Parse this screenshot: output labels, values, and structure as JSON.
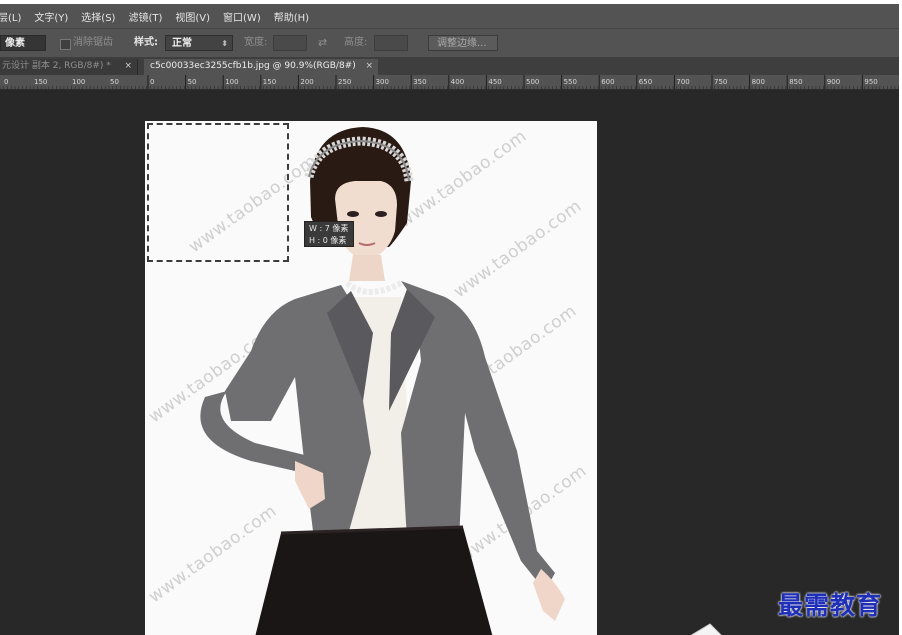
{
  "menu": {
    "items": [
      "层(L)",
      "文字(Y)",
      "选择(S)",
      "滤镜(T)",
      "视图(V)",
      "窗口(W)",
      "帮助(H)"
    ]
  },
  "options": {
    "feather_value": "像素",
    "antialias_label": "消除锯齿",
    "style_label": "样式:",
    "style_value": "正常",
    "width_label": "宽度:",
    "height_label": "高度:",
    "refine_edge_button": "调整边缘..."
  },
  "tabs": [
    {
      "label": "元设计 副本 2, RGB/8#) *",
      "active": false
    },
    {
      "label": "c5c00033ec3255cfb1b.jpg @ 90.9%(RGB/8#)",
      "active": true
    }
  ],
  "ruler": {
    "left_labels": [
      "0",
      "150",
      "100",
      "50"
    ],
    "labels": [
      "0",
      "50",
      "100",
      "150",
      "200",
      "250",
      "300",
      "350",
      "400",
      "450",
      "500",
      "550",
      "600",
      "650",
      "700",
      "750",
      "800",
      "850",
      "900",
      "950"
    ]
  },
  "tooltip": {
    "w_line": "W : 7 像素",
    "h_line": "H : 0 像素"
  },
  "watermark": {
    "text": "www.taobao.com"
  },
  "brand": {
    "text": "最需教育",
    "color": "#1f2fb8"
  },
  "colors": {
    "menubar_bg": "#535353",
    "workspace_bg": "#282828",
    "document_bg": "#fafafa",
    "jacket": "#6f6f72",
    "skirt": "#1b1616"
  }
}
